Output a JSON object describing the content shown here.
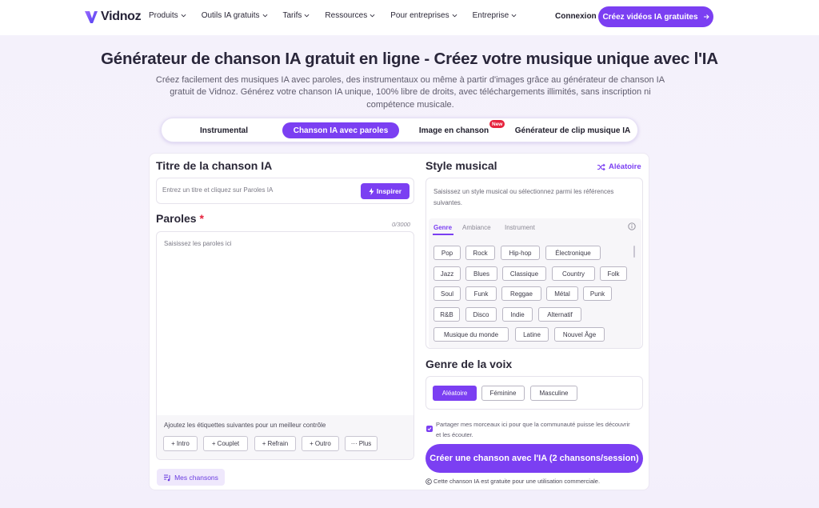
{
  "nav": {
    "logo_text": "Vidnoz",
    "menu": [
      "Produits",
      "Outils IA gratuits",
      "Tarifs",
      "Ressources",
      "Pour entreprises",
      "Entreprise"
    ],
    "login": "Connexion",
    "cta": "Créez vidéos IA gratuites"
  },
  "hero": {
    "title": "Générateur de chanson IA gratuit en ligne - Créez votre musique unique avec l'IA",
    "subtitle": "Créez facilement des musiques IA avec paroles, des instrumentaux ou même à partir d'images grâce au générateur de chanson IA gratuit de Vidnoz. Générez votre chanson IA unique, 100% libre de droits, avec téléchargements illimités, sans inscription ni compétence musicale."
  },
  "tabs": {
    "items": [
      "Instrumental",
      "Chanson IA avec paroles",
      "Image en chanson",
      "Générateur de clip musique IA"
    ],
    "active_index": 1,
    "badge": "New"
  },
  "left": {
    "title_heading": "Titre de la chanson IA",
    "title_placeholder": "Entrez un titre et cliquez sur Paroles IA",
    "inspire": "Inspirer",
    "lyrics_heading": "Paroles",
    "lyrics_required": "*",
    "counter": "0/3000",
    "lyrics_placeholder": "Saisissez les paroles ici",
    "hint": "Ajoutez les étiquettes suivantes pour un meilleur contrôle",
    "tags": [
      "Intro",
      "Couplet",
      "Refrain",
      "Outro",
      "Plus"
    ],
    "my_songs": "Mes chansons"
  },
  "right": {
    "style_heading": "Style musical",
    "random": "Aléatoire",
    "style_desc": "Saisissez un style musical ou sélectionnez parmi les références suivantes.",
    "subtabs": [
      "Genre",
      "Ambiance",
      "Instrument"
    ],
    "genres": [
      "Pop",
      "Rock",
      "Hip-hop",
      "Électronique",
      "Jazz",
      "Blues",
      "Classique",
      "Country",
      "Folk",
      "Soul",
      "Funk",
      "Reggae",
      "Métal",
      "Punk",
      "R&B",
      "Disco",
      "Indie",
      "Alternatif",
      "Musique du monde",
      "Latine",
      "Nouvel Âge"
    ],
    "voice_heading": "Genre de la voix",
    "voices": [
      "Aléatoire",
      "Féminine",
      "Masculine"
    ],
    "share_text": "Partager mes morceaux ici pour que la communauté puisse les découvrir et les écouter.",
    "create_button": "Créer une chanson avec l'IA (2 chansons/session)",
    "free_note": "Cette chanson IA est gratuite pour une utilisation commerciale."
  },
  "colors": {
    "accent": "#7b3ff2",
    "badge": "#e6233d",
    "background": "#f4f1fb"
  }
}
